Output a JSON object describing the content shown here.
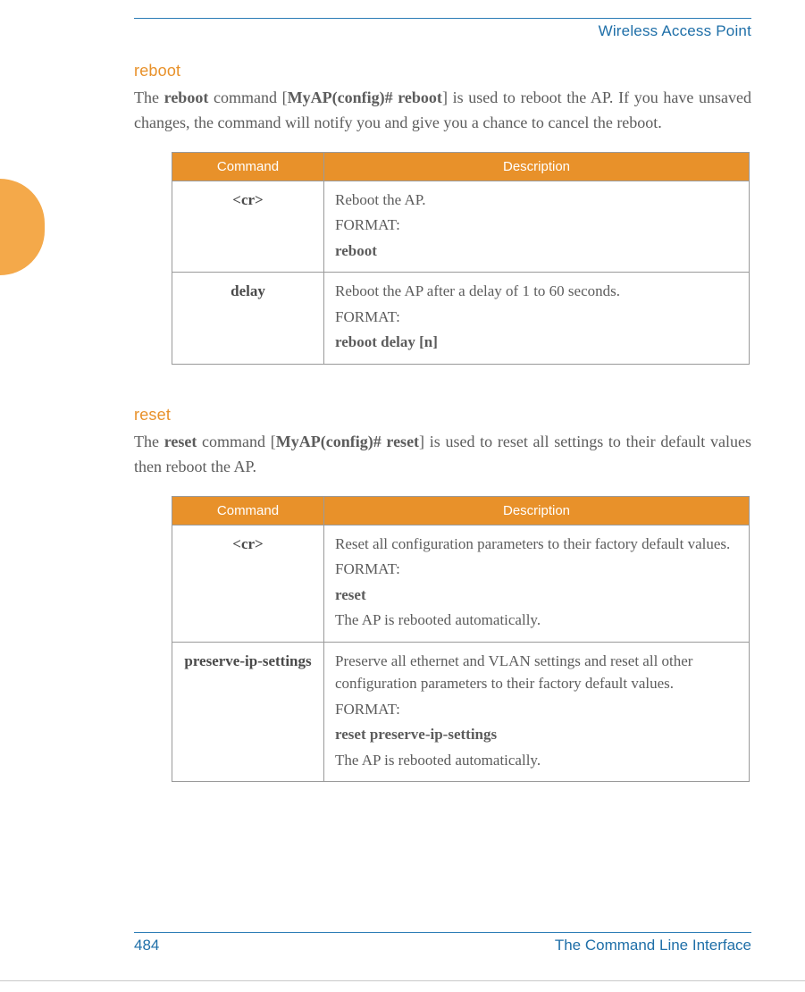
{
  "header": {
    "doc_title": "Wireless Access Point"
  },
  "sections": {
    "reboot": {
      "title": "reboot",
      "intro_parts": {
        "p1": "The ",
        "b1": "reboot",
        "p2": " command [",
        "b2": "MyAP(config)# reboot",
        "p3": "] is used to reboot the AP. If you have unsaved changes, the command will notify you and give you a chance to cancel the reboot."
      },
      "table": {
        "headers": {
          "command": "Command",
          "description": "Description"
        },
        "rows": [
          {
            "cmd": "<cr>",
            "desc": {
              "l1": "Reboot the AP.",
              "l2": "FORMAT:",
              "l3": "reboot"
            }
          },
          {
            "cmd": "delay",
            "desc": {
              "l1": "Reboot the AP after a delay of 1 to 60 seconds.",
              "l2": "FORMAT:",
              "l3": "reboot delay [n]"
            }
          }
        ]
      }
    },
    "reset": {
      "title": "reset",
      "intro_parts": {
        "p1": "The ",
        "b1": "reset",
        "p2": " command [",
        "b2": "MyAP(config)# reset",
        "p3": "] is used to reset all settings to their default values then reboot the AP."
      },
      "table": {
        "headers": {
          "command": "Command",
          "description": "Description"
        },
        "rows": [
          {
            "cmd": "<cr>",
            "desc": {
              "l1": "Reset all configuration parameters to their factory default values.",
              "l2": "FORMAT:",
              "l3": "reset",
              "l4": "The AP is rebooted automatically."
            }
          },
          {
            "cmd": "preserve-ip-settings",
            "desc": {
              "l1": "Preserve all ethernet and VLAN settings and reset all other configuration parameters to their factory default values.",
              "l2": "FORMAT:",
              "l3": "reset preserve-ip-settings",
              "l4": "The AP is rebooted automatically."
            }
          }
        ]
      }
    }
  },
  "footer": {
    "page_number": "484",
    "chapter": "The Command Line Interface"
  }
}
